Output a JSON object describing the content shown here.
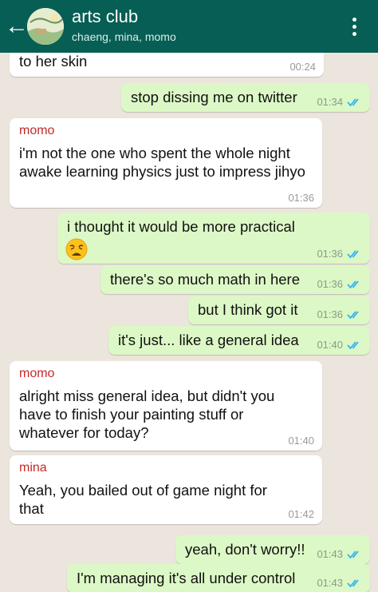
{
  "header": {
    "title": "arts club",
    "subtitle": "chaeng, mina, momo",
    "back_icon": "arrow-left-icon",
    "menu_icon": "more-vert-icon"
  },
  "messages": [
    {
      "direction": "in",
      "text": "to her skin",
      "time": "00:24"
    },
    {
      "direction": "out",
      "text": "stop dissing me on twitter",
      "time": "01:34",
      "status": "read"
    },
    {
      "direction": "in",
      "sender": "momo",
      "text": "i'm not the one who spent the whole night awake learning physics just to impress jihyo",
      "time": "01:36"
    },
    {
      "direction": "out",
      "text": "i thought it would be more practical",
      "emoji": "weary-face",
      "time": "01:36",
      "status": "read"
    },
    {
      "direction": "out",
      "text": "there's so much math in here",
      "time": "01:36",
      "status": "read"
    },
    {
      "direction": "out",
      "text": "but I think got it",
      "time": "01:36",
      "status": "read"
    },
    {
      "direction": "out",
      "text": "it's just... like a general idea",
      "time": "01:40",
      "status": "read"
    },
    {
      "direction": "in",
      "sender": "momo",
      "text": "alright miss general idea, but didn't you have to finish your painting stuff or whatever for today?",
      "time": "01:40"
    },
    {
      "direction": "in",
      "sender": "mina",
      "text": "Yeah, you bailed out of game night for that",
      "time": "01:42"
    },
    {
      "direction": "out",
      "text": "yeah, don't worry!!",
      "time": "01:43",
      "status": "read"
    },
    {
      "direction": "out",
      "text": "I'm managing it's all under control",
      "time": "01:43",
      "status": "read"
    }
  ],
  "colors": {
    "header": "#075e54",
    "background": "#ece5dd",
    "incoming_bubble": "#ffffff",
    "outgoing_bubble": "#dcf8c6",
    "sender_name": "#c62828",
    "read_ticks": "#34b7f1"
  }
}
